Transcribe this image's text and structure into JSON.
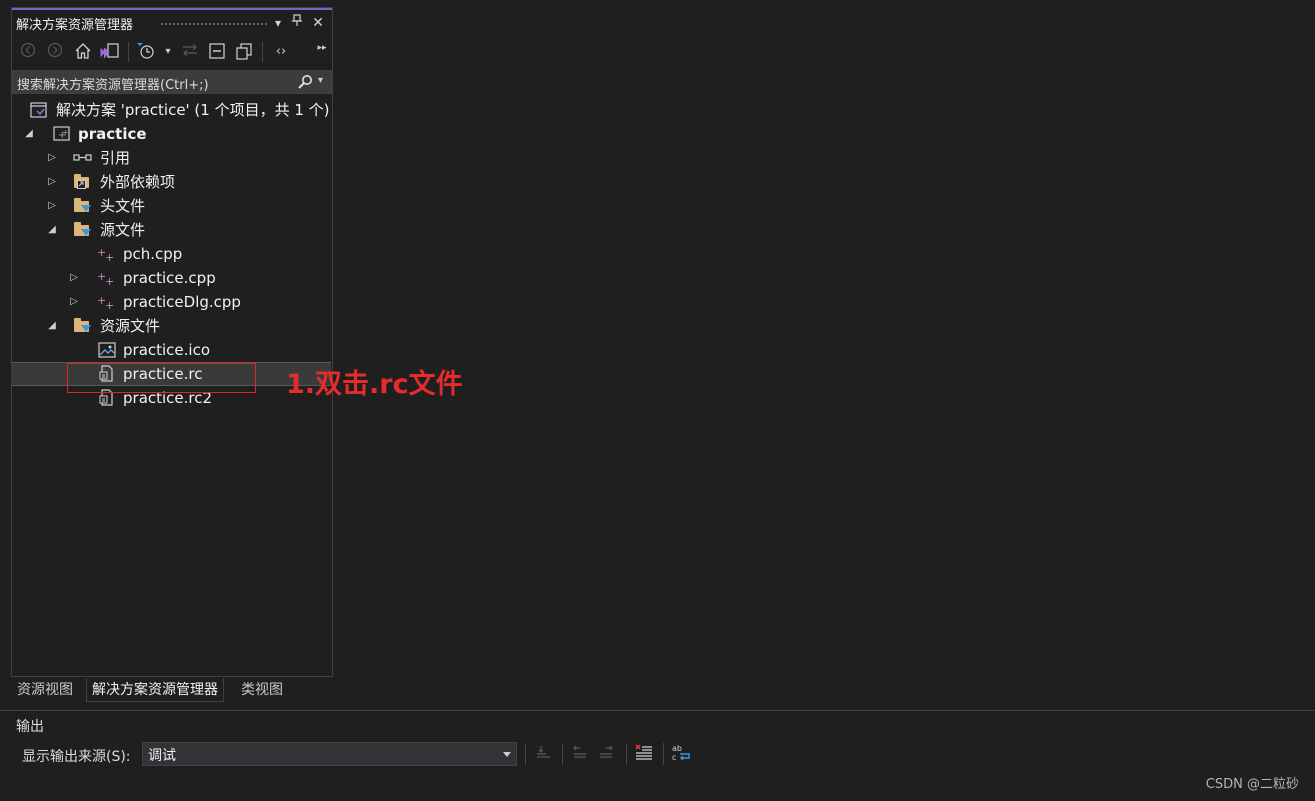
{
  "solution_explorer": {
    "title": "解决方案资源管理器",
    "search_placeholder": "搜索解决方案资源管理器(Ctrl+;)",
    "solution_label": "解决方案 'practice' (1 个项目，共 1 个)",
    "project_label": "practice",
    "items": {
      "references": "引用",
      "external_deps": "外部依赖项",
      "header_files": "头文件",
      "source_files": "源文件",
      "pch_cpp": "pch.cpp",
      "practice_cpp": "practice.cpp",
      "practicedlg_cpp": "practiceDlg.cpp",
      "resource_files": "资源文件",
      "practice_ico": "practice.ico",
      "practice_rc": "practice.rc",
      "practice_rc2": "practice.rc2"
    }
  },
  "annotation": {
    "text": "1.双击.rc文件",
    "color": "#e42c2c"
  },
  "bottom_tabs": {
    "resource_view": "资源视图",
    "solution_explorer": "解决方案资源管理器",
    "class_view": "类视图"
  },
  "output": {
    "title": "输出",
    "source_label": "显示输出来源(S):",
    "source_value": "调试"
  },
  "watermark": "CSDN @二粒砂",
  "colors": {
    "accent": "#8060c8",
    "background": "#1f1f1f",
    "folder": "#dcb67a",
    "cpp_plus": "#c586c0"
  }
}
